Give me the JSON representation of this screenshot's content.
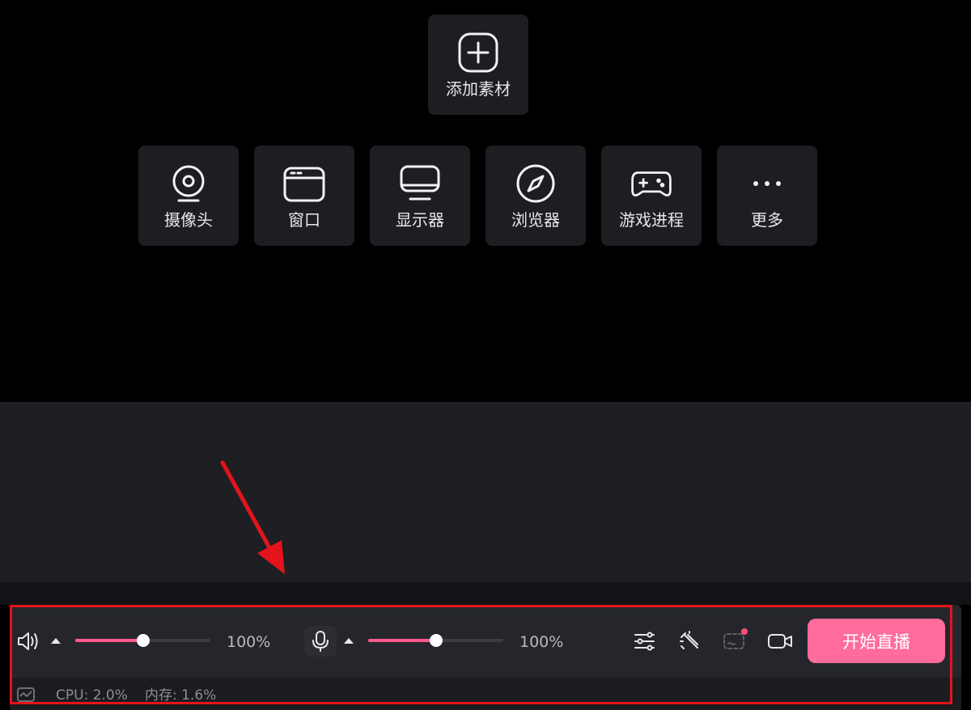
{
  "add_source": {
    "label": "添加素材",
    "icon": "plus-square-icon"
  },
  "sources": [
    {
      "label": "摄像头",
      "icon": "webcam-icon"
    },
    {
      "label": "窗口",
      "icon": "window-icon"
    },
    {
      "label": "显示器",
      "icon": "monitor-icon"
    },
    {
      "label": "浏览器",
      "icon": "compass-icon"
    },
    {
      "label": "游戏进程",
      "icon": "gamepad-icon"
    },
    {
      "label": "更多",
      "icon": "more-dots-icon"
    }
  ],
  "audio": {
    "speaker": {
      "icon": "speaker-icon",
      "volume_percent": 50,
      "value_label": "100%"
    },
    "mic": {
      "icon": "microphone-icon",
      "volume_percent": 50,
      "value_label": "100%"
    }
  },
  "toolbar_icons": [
    "sliders-icon",
    "magic-wand-icon",
    "multi-screen-icon",
    "video-camera-icon"
  ],
  "start_live": {
    "label": "开始直播",
    "color": "#ff6c9c"
  },
  "status": {
    "cpu": "CPU: 2.0%",
    "memory": "内存: 1.6%",
    "icon": "performance-monitor-icon"
  },
  "colors": {
    "accent": "#ff5a8c",
    "highlight_box": "#e3141b",
    "notification_dot": "#ff4d79"
  }
}
